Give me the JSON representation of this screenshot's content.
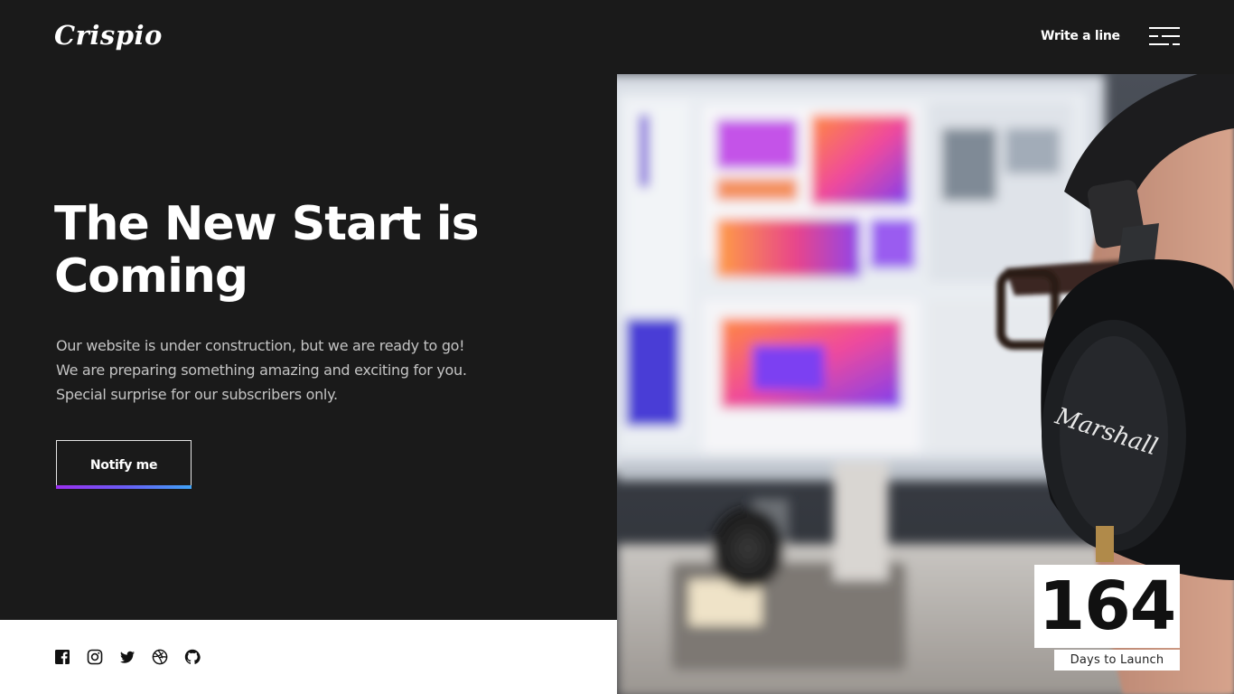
{
  "brand": {
    "name": "Crispio"
  },
  "nav": {
    "cta_label": "Write a line",
    "menu_icon": "hamburger-menu-icon"
  },
  "hero": {
    "headline": "The New Start is Coming",
    "description_lines": [
      "Our website is under construction, but we are ready to go!",
      "We are preparing something amazing and exciting for you.",
      "Special surprise for our subscribers only."
    ],
    "notify_label": "Notify me"
  },
  "countdown": {
    "value": "164",
    "label": "Days to Launch"
  },
  "social": [
    {
      "icon": "facebook-icon"
    },
    {
      "icon": "instagram-icon"
    },
    {
      "icon": "twitter-icon"
    },
    {
      "icon": "dribbble-icon"
    },
    {
      "icon": "github-icon"
    }
  ],
  "colors": {
    "background": "#1a1a1a",
    "text": "#ffffff",
    "muted_text": "#c4c4c4",
    "accent_gradient_start": "#9b2ff0",
    "accent_gradient_end": "#3fa2f7",
    "footer_band": "#ffffff"
  }
}
